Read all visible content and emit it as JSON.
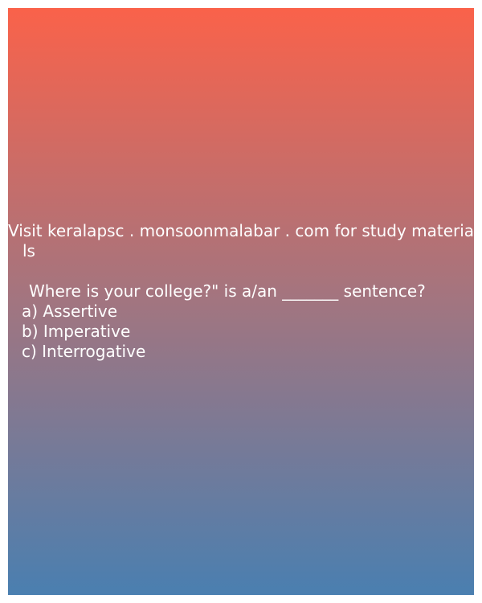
{
  "promo": {
    "line1": "Visit keralapsc . monsoonmalabar . com for study materia",
    "line2": "ls"
  },
  "question": {
    "text": "Where is your college?\" is a/an _______ sentence?"
  },
  "options": [
    "a) Assertive",
    "b) Imperative",
    "c) Interrogative"
  ],
  "colors": {
    "gradient_top": "#fa624a",
    "gradient_middle": "#a27580",
    "gradient_bottom": "#4a7fb0",
    "text": "#ffffff"
  }
}
